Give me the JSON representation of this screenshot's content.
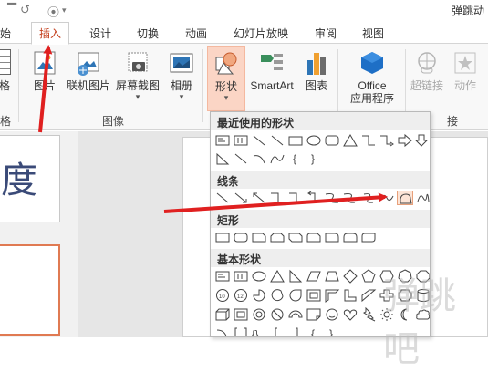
{
  "app": {
    "title_fragment": "弹跳动"
  },
  "quick_access": [
    {
      "name": "undo-icon"
    },
    {
      "name": "from-beginning-icon"
    },
    {
      "name": "customize-quick-access-icon"
    }
  ],
  "tabs": [
    {
      "label": "开始",
      "display": "始"
    },
    {
      "label": "插入",
      "display": "插入",
      "active": true
    },
    {
      "label": "设计",
      "display": "设计"
    },
    {
      "label": "切换",
      "display": "切换"
    },
    {
      "label": "动画",
      "display": "动画"
    },
    {
      "label": "幻灯片放映",
      "display": "幻灯片放映"
    },
    {
      "label": "审阅",
      "display": "审阅"
    },
    {
      "label": "视图",
      "display": "视图"
    }
  ],
  "ribbon": {
    "buttons": {
      "table_fragment": "格",
      "picture": "图片",
      "online_picture": "联机图片",
      "screenshot": "屏幕截图",
      "album": "相册",
      "shapes": "形状",
      "smartart": "SmartArt",
      "chart": "图表",
      "office_apps_line1": "Office",
      "office_apps_line2": "应用程序",
      "hyperlink": "超链接",
      "action": "动作"
    },
    "groups": {
      "table_fragment": "格",
      "images": "图像",
      "links_fragment": "接"
    }
  },
  "slides": {
    "thumb_text": "度"
  },
  "shapes_dropdown": {
    "sections": {
      "recent": "最近使用的形状",
      "lines": "线条",
      "rectangles": "矩形",
      "basic": "基本形状"
    },
    "highlighted_shape": "freeform-shape"
  },
  "colors": {
    "accent": "#c43e1c",
    "arrow": "#e02020",
    "shape_button_bg": "#fbd5c5"
  },
  "watermark": "弹跳吧"
}
